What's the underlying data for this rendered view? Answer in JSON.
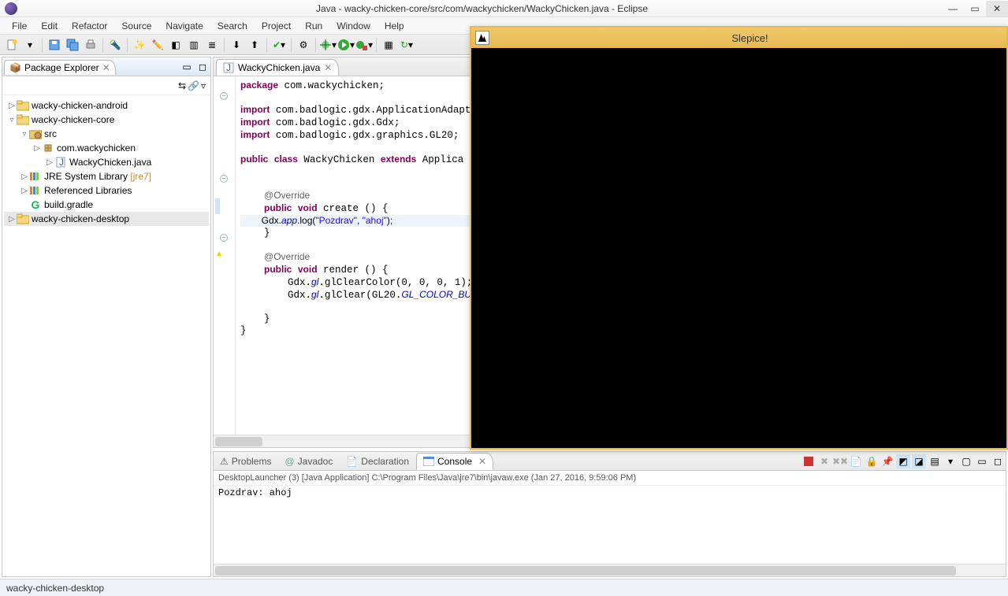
{
  "window": {
    "title": "Java - wacky-chicken-core/src/com/wackychicken/WackyChicken.java - Eclipse"
  },
  "menu": [
    "File",
    "Edit",
    "Refactor",
    "Source",
    "Navigate",
    "Search",
    "Project",
    "Run",
    "Window",
    "Help"
  ],
  "package_explorer": {
    "title": "Package Explorer",
    "tree": [
      {
        "d": 0,
        "t": "▷",
        "icon": "project",
        "label": "wacky-chicken-android"
      },
      {
        "d": 0,
        "t": "▿",
        "icon": "project",
        "label": "wacky-chicken-core"
      },
      {
        "d": 1,
        "t": "▿",
        "icon": "srcfolder",
        "label": "src"
      },
      {
        "d": 2,
        "t": "▷",
        "icon": "package",
        "label": "com.wackychicken"
      },
      {
        "d": 3,
        "t": "▷",
        "icon": "jfile",
        "label": "WackyChicken.java"
      },
      {
        "d": 1,
        "t": "▷",
        "icon": "library",
        "label": "JRE System Library",
        "suffix": " [jre7]"
      },
      {
        "d": 1,
        "t": "▷",
        "icon": "library",
        "label": "Referenced Libraries"
      },
      {
        "d": 1,
        "t": "",
        "icon": "gradle",
        "label": "build.gradle"
      },
      {
        "d": 0,
        "t": "▷",
        "icon": "project",
        "label": "wacky-chicken-desktop",
        "selected": true
      }
    ]
  },
  "editor": {
    "filename": "WackyChicken.java"
  },
  "bottom": {
    "tabs": [
      "Problems",
      "Javadoc",
      "Declaration",
      "Console"
    ],
    "active": "Console",
    "console_header": "DesktopLauncher (3) [Java Application] C:\\Program Files\\Java\\jre7\\bin\\javaw.exe (Jan 27, 2016, 9:59:06 PM)",
    "console_output": "Pozdrav: ahoj"
  },
  "statusbar": {
    "text": "wacky-chicken-desktop"
  },
  "app_window": {
    "title": "Slepice!"
  }
}
